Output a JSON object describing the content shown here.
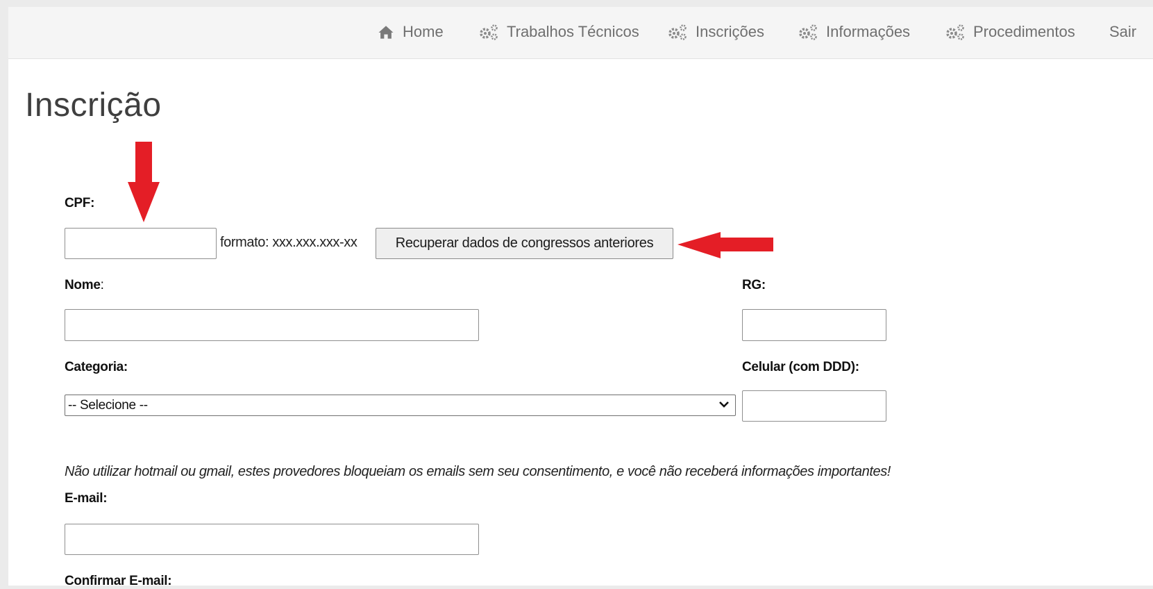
{
  "nav": {
    "items": [
      {
        "label": "Home",
        "icon": "home-icon"
      },
      {
        "label": "Trabalhos Técnicos",
        "icon": "gears-icon"
      },
      {
        "label": "Inscrições",
        "icon": "gears-icon"
      },
      {
        "label": "Informações",
        "icon": "gears-icon"
      },
      {
        "label": "Procedimentos",
        "icon": "gears-icon"
      },
      {
        "label": "Sair",
        "icon": ""
      }
    ]
  },
  "page": {
    "title": "Inscrição"
  },
  "form": {
    "cpf": {
      "label": "CPF:",
      "value": "",
      "format_hint": "formato: xxx.xxx.xxx-xx"
    },
    "recover_button": "Recuperar dados de congressos anteriores",
    "nome": {
      "label": "Nome",
      "colon": ":",
      "value": ""
    },
    "rg": {
      "label": "RG:",
      "value": ""
    },
    "categoria": {
      "label": "Categoria:",
      "selected": "-- Selecione --"
    },
    "celular": {
      "label": "Celular (com DDD):",
      "value": ""
    },
    "email_note": "Não utilizar hotmail ou gmail, estes provedores bloqueiam os emails sem seu consentimento, e você não receberá informações importantes!",
    "email": {
      "label": "E-mail:",
      "value": ""
    },
    "confirm_email": {
      "label": "Confirmar E-mail:"
    }
  },
  "colors": {
    "annotation_arrow": "#e41e26",
    "nav_text": "#6f6f6f"
  }
}
